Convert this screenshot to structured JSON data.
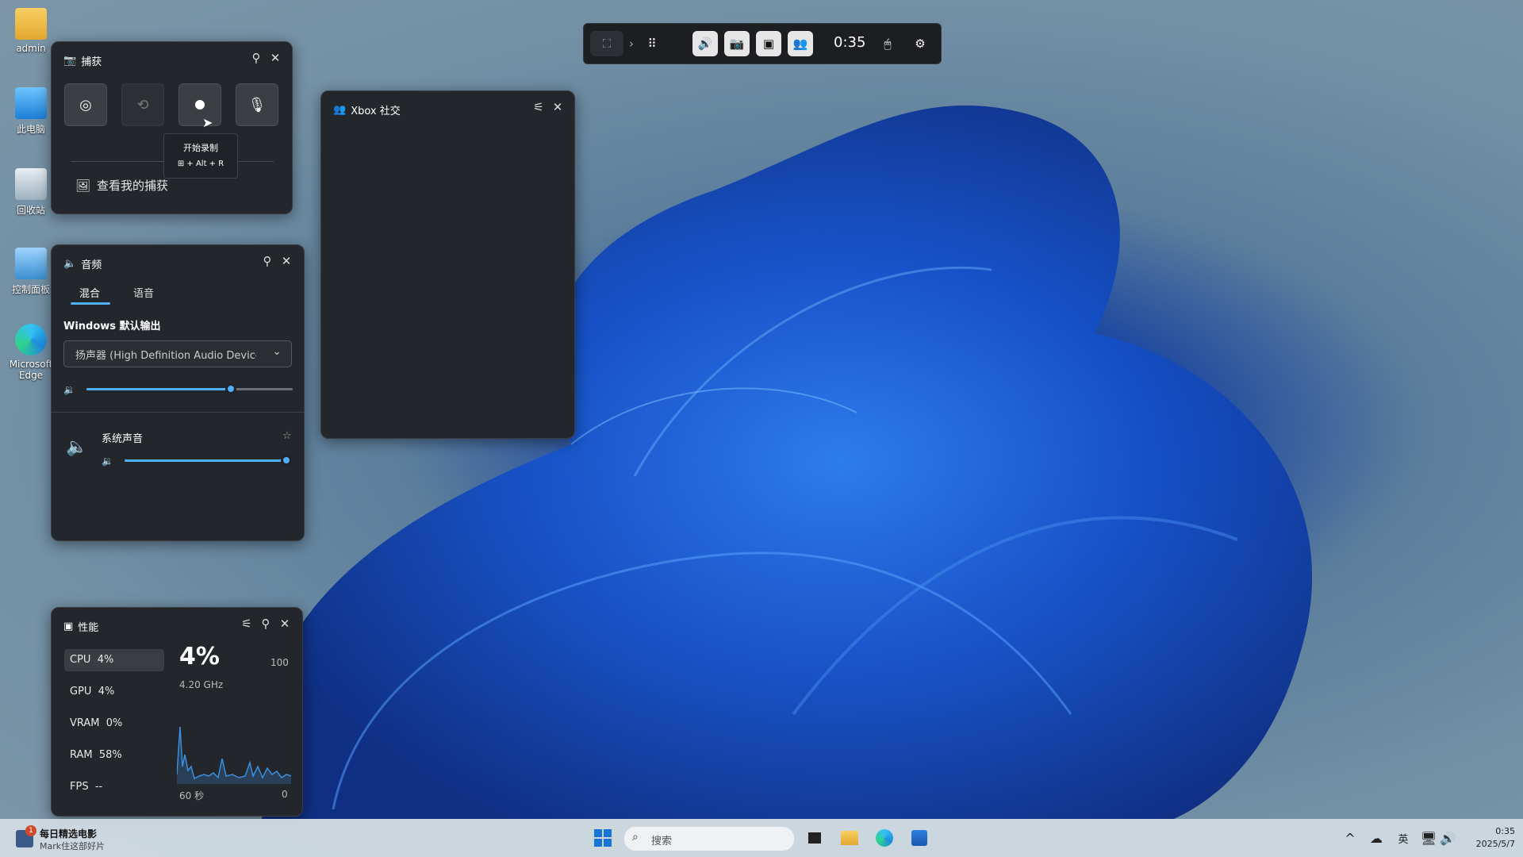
{
  "desktop": {
    "icons": [
      {
        "label": "admin"
      },
      {
        "label": "此电脑"
      },
      {
        "label": "回收站"
      },
      {
        "label": "控制面板"
      },
      {
        "label": "Microsoft Edge"
      }
    ]
  },
  "gamebar": {
    "timer": "0:35"
  },
  "capture": {
    "title": "捕获",
    "tooltip_title": "开始录制",
    "tooltip_shortcut": "+ Alt + R",
    "view_captures": "查看我的捕获"
  },
  "xbox": {
    "title": "Xbox 社交"
  },
  "audio": {
    "title": "音频",
    "tabs": [
      "混合",
      "语音"
    ],
    "output_label": "Windows 默认输出",
    "device": "扬声器 (High Definition Audio Device)",
    "master_volume": 0.7,
    "app_name": "系统声音",
    "app_volume": 1.0
  },
  "perf": {
    "title": "性能",
    "metrics": [
      {
        "name": "CPU",
        "value": "4%"
      },
      {
        "name": "GPU",
        "value": "4%"
      },
      {
        "name": "VRAM",
        "value": "0%"
      },
      {
        "name": "RAM",
        "value": "58%"
      },
      {
        "name": "FPS",
        "value": "--"
      }
    ],
    "big_value": "4%",
    "max_label": "100",
    "freq": "4.20 GHz",
    "x_left": "60 秒",
    "x_right": "0"
  },
  "taskbar": {
    "news_title": "每日精选电影",
    "news_sub": "Mark住这部好片",
    "badge": "1",
    "search_placeholder": "搜索",
    "ime": "英",
    "time": "0:35",
    "date": "2025/5/7"
  }
}
